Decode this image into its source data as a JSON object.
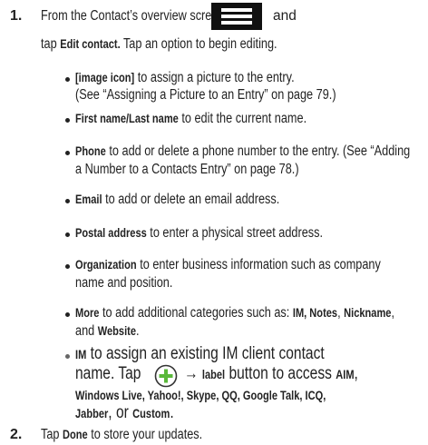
{
  "step1": {
    "number": "1.",
    "line1_text": "From the Contact’s overview screen, press",
    "line1_after": "and",
    "line2_pre": "tap",
    "line2_bold": "Edit contact.",
    "line2_post": "Tap an option to begin editing."
  },
  "icons": {
    "menu_key": "menu-key-icon",
    "add_plus": "green-plus-circle-icon",
    "arrow": "→"
  },
  "bullets": [
    {
      "bold": "[image icon]",
      "text": "to assign a picture to the entry.",
      "line2": "(See “Assigning a Picture to an Entry” on page 79.)"
    },
    {
      "bold": "First name/Last name",
      "text": "to edit the current name."
    },
    {
      "bold": "Phone",
      "text": "to add or delete a phone number to the entry. (See “Adding",
      "line2": "a Number to a Contacts Entry” on page 78.)"
    },
    {
      "bold": "Email",
      "text": "to add or delete an email address."
    },
    {
      "bold": "Postal address",
      "text": "to enter a physical street address."
    },
    {
      "bold": "Organization",
      "text": "to enter business information such as company",
      "line2": "name and position."
    },
    {
      "bold": "More",
      "text": "to add additional categories such as:",
      "b2": "IM, Notes",
      "sep": ",",
      "b3": "Nickname",
      "end": ",",
      "line2_pre": "and",
      "line2_bold": "Website",
      "line2_end": "."
    }
  ],
  "subbullet": {
    "bold": "IM",
    "text": "to assign an existing IM client contact",
    "line2_pre": "name. Tap",
    "line2_bold": "label",
    "line2_post": "button to access",
    "line2_aim": "AIM",
    "line2_end": ",",
    "line3": "Windows Live, Yahoo!, Skype, QQ, Google Talk, ICQ,",
    "line4_bold": "Jabber",
    "line4_mid": ", or",
    "line4_bold2": "Custom",
    "line4_end": "."
  },
  "step2": {
    "number": "2.",
    "pre": "Tap",
    "bold": "Done",
    "post": "to store your updates."
  }
}
